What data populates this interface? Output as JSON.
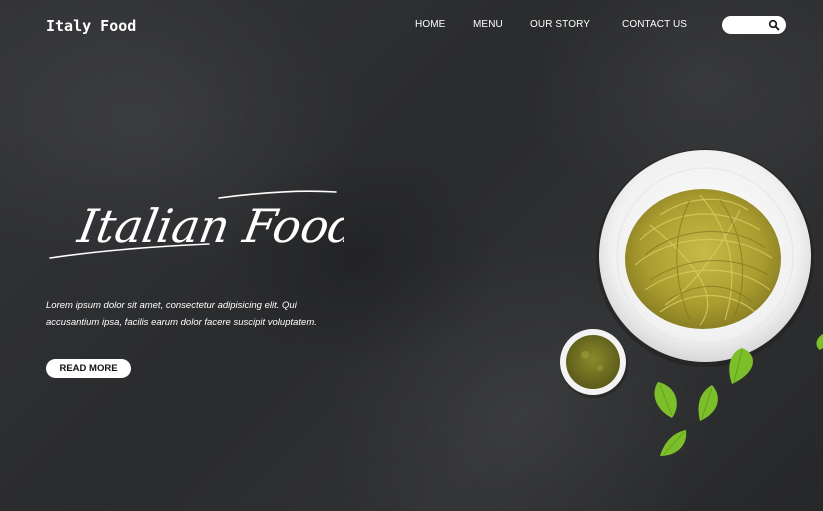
{
  "header": {
    "brand": "Italy Food",
    "nav": [
      {
        "label": "HOME"
      },
      {
        "label": "MENU"
      },
      {
        "label": "OUR STORY"
      },
      {
        "label": "CONTACT US"
      }
    ],
    "search": {
      "placeholder": "",
      "icon": "search-icon"
    }
  },
  "hero": {
    "title": "Italian Food",
    "description": "Lorem ipsum dolor sit amet, consectetur adipisicing elit. Qui accusantium ipsa, facilis earum dolor facere suscipit voluptatem.",
    "button_label": "READ MORE"
  },
  "colors": {
    "background": "#2b2c2e",
    "text": "#ffffff",
    "pasta": "#b7a93a",
    "basil": "#7cbf2a"
  }
}
